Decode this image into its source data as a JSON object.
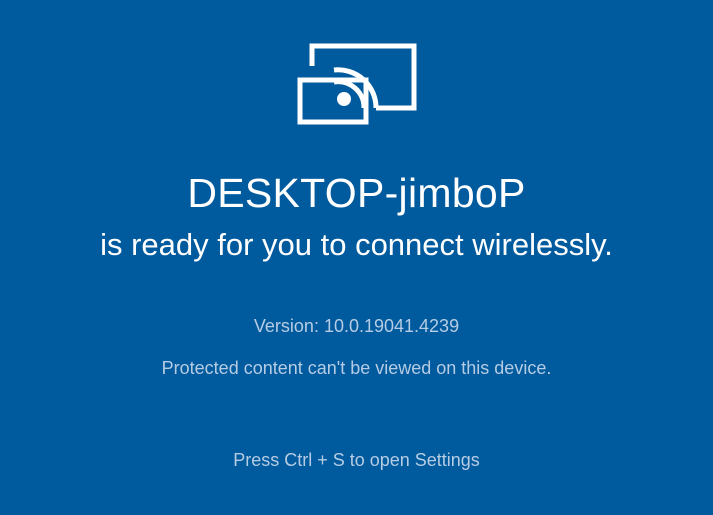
{
  "app": {
    "icon": "wireless-display-icon",
    "background_color": "#005a9e",
    "primary_text_color": "#ffffff",
    "secondary_text_color": "#b6cce3"
  },
  "main": {
    "device_name": "DESKTOP-jimboP",
    "ready_message": "is ready for you to connect wirelessly.",
    "version": "Version: 10.0.19041.4239",
    "protected_notice": "Protected content can't be viewed on this device.",
    "settings_hint": "Press Ctrl + S to open Settings"
  }
}
